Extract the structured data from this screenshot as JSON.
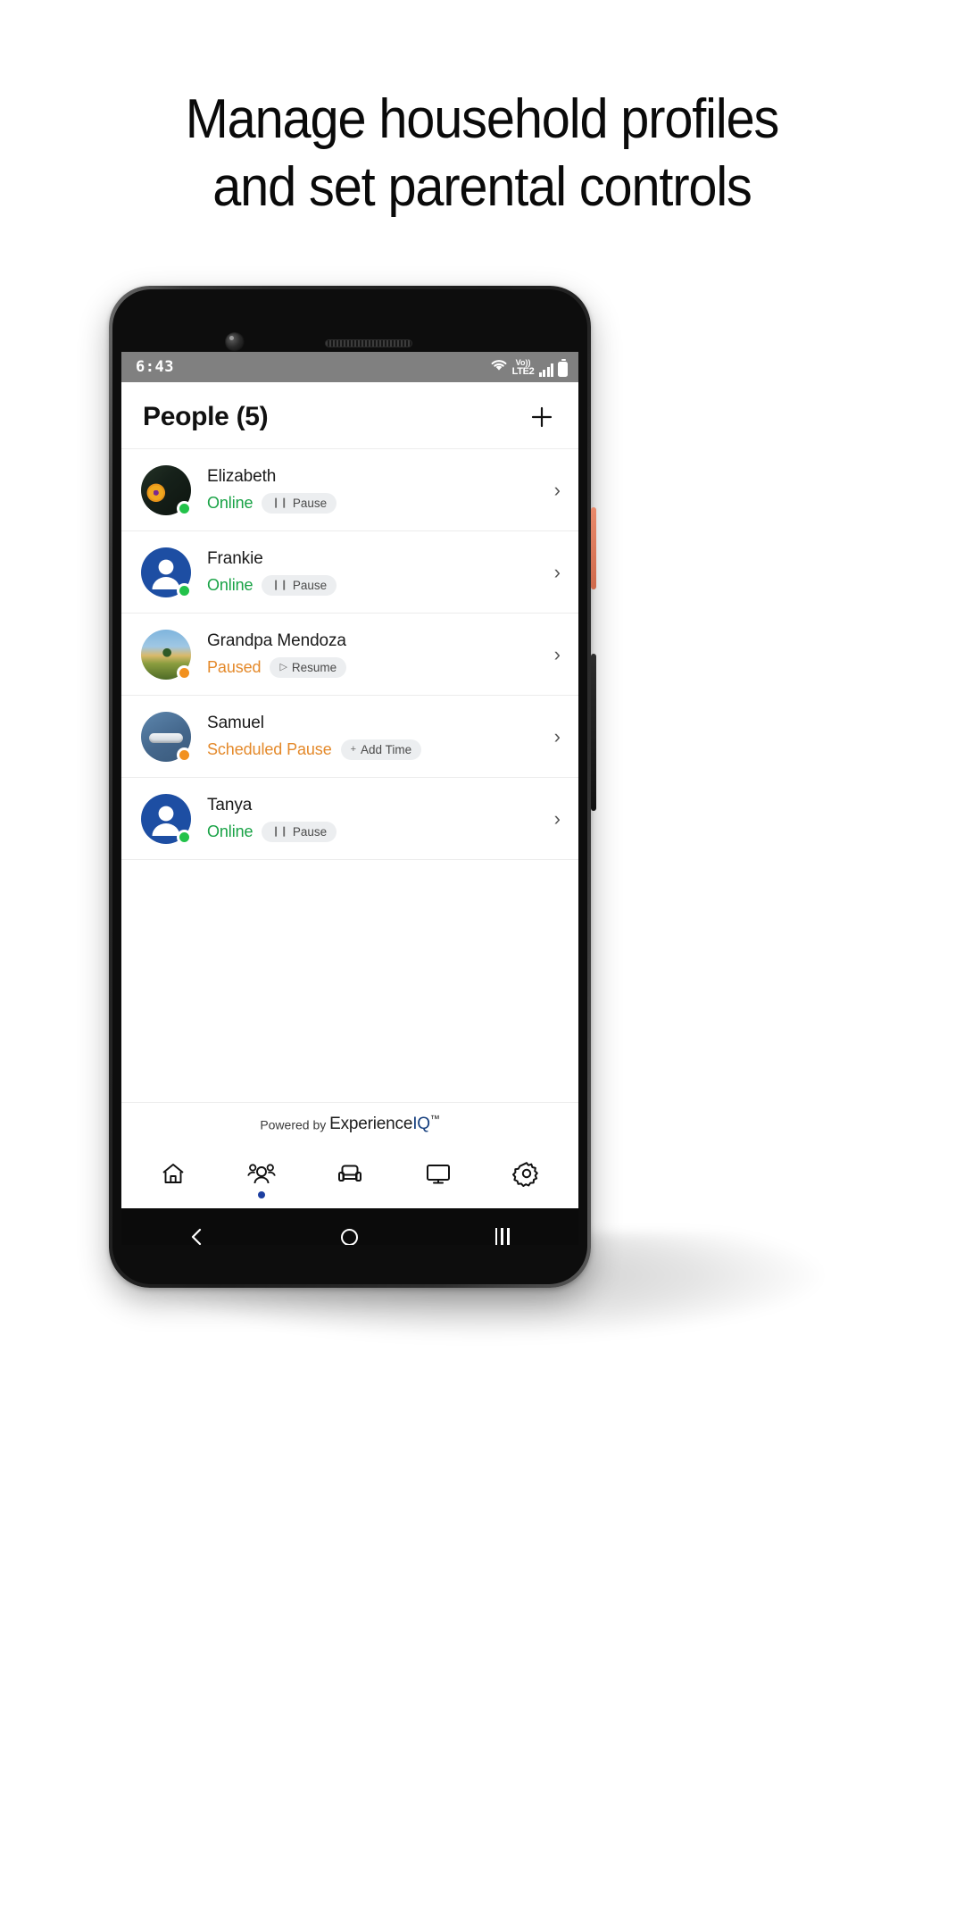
{
  "headline": {
    "line1": "Manage household profiles",
    "line2": "and set parental controls"
  },
  "statusbar": {
    "time": "6:43",
    "volte_top": "Vo))",
    "volte_bottom": "LTE2"
  },
  "app": {
    "header": {
      "title": "People (5)",
      "add_label": "+"
    },
    "people": [
      {
        "name": "Elizabeth",
        "status": "Online",
        "status_kind": "online",
        "action_label": "Pause",
        "action_glyph": "❙❙",
        "avatar": "photo-flower",
        "chevron": "›"
      },
      {
        "name": "Frankie",
        "status": "Online",
        "status_kind": "online",
        "action_label": "Pause",
        "action_glyph": "❙❙",
        "avatar": "person-blue",
        "chevron": "›"
      },
      {
        "name": "Grandpa Mendoza",
        "status": "Paused",
        "status_kind": "paused",
        "action_label": "Resume",
        "action_glyph": "▷",
        "avatar": "photo-field",
        "chevron": "›"
      },
      {
        "name": "Samuel",
        "status": "Scheduled Pause",
        "status_kind": "paused",
        "action_label": "Add Time",
        "action_glyph": "+",
        "avatar": "photo-device",
        "chevron": "›"
      },
      {
        "name": "Tanya",
        "status": "Online",
        "status_kind": "online",
        "action_label": "Pause",
        "action_glyph": "❙❙",
        "avatar": "person-blue",
        "chevron": "›"
      }
    ],
    "footer": {
      "powered_prefix": "Powered by ",
      "brand_experience": "Experience",
      "brand_iq": "IQ",
      "brand_tm": "™"
    },
    "bottom_nav": [
      {
        "icon": "home-icon",
        "active": false
      },
      {
        "icon": "people-icon",
        "active": true
      },
      {
        "icon": "sofa-icon",
        "active": false
      },
      {
        "icon": "monitor-icon",
        "active": false
      },
      {
        "icon": "gear-icon",
        "active": false
      }
    ]
  },
  "colors": {
    "online_green": "#18a245",
    "paused_orange": "#e4892a",
    "brand_blue": "#17407f",
    "nav_active_dot": "#1d3fa0"
  }
}
